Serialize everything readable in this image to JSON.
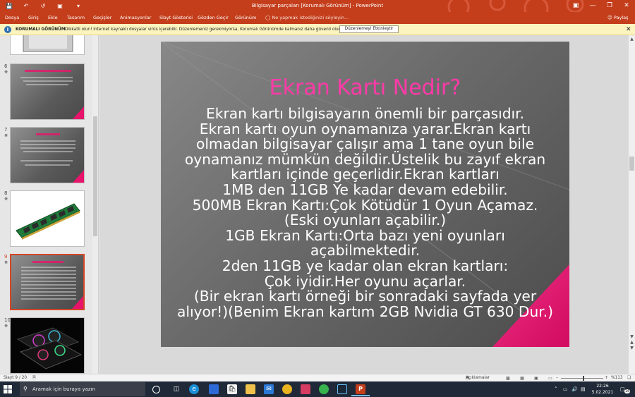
{
  "window": {
    "title": "Bilgisayar parçaları [Korumalı Görünüm] - PowerPoint"
  },
  "ribbon": {
    "tabs": [
      "Dosya",
      "Giriş",
      "Ekle",
      "Tasarım",
      "Geçişler",
      "Animasyonlar",
      "Slayt Gösterisi",
      "Gözden Geçir",
      "Görünüm"
    ],
    "tell_me_placeholder": "Ne yapmak istediğinizi söyleyin...",
    "share_label": "Paylaş"
  },
  "protected_view": {
    "heading": "KORUMALI GÖRÜNÜM",
    "message": "Dikkatli olun! Internet kaynaklı dosyalar virüs içerebilir. Düzenlemeniz gerekmiyorsa, Korumalı Görünümde kalmanız daha güvenli olur.",
    "enable_button": "Düzenlemeyi Etkinleştir"
  },
  "thumbnails": [
    {
      "number": "6"
    },
    {
      "number": "7"
    },
    {
      "number": "8"
    },
    {
      "number": "9"
    },
    {
      "number": "10"
    }
  ],
  "slide": {
    "title": "Ekran Kartı Nedir?",
    "body_lines": [
      "Ekran kartı bilgisayarın önemli bir parçasıdır.",
      "Ekran kartı oyun oynamanıza yarar.Ekran kartı",
      "olmadan bilgisayar çalışır ama 1 tane oyun bile",
      "oynamanız mümkün değildir.Üstelik bu zayıf ekran",
      "kartları içinde geçerlidir.Ekran kartları",
      "1MB den 11GB Ye kadar devam edebilir.",
      "500MB Ekran Kartı:Çok Kötüdür 1 Oyun Açamaz.",
      "(Eski oyunları açabilir.)",
      "1GB Ekran Kartı:Orta bazı yeni oyunları",
      "açabilmektedir.",
      "2den 11GB ye kadar olan ekran kartları:",
      "Çok iyidir.Her oyunu açarlar.",
      "(Bir ekran kartı örneği bir sonradaki sayfada yer",
      "alıyor!)(Benim Ekran kartım 2GB Nvidia GT 630 Dur.)"
    ]
  },
  "status": {
    "slide_counter": "Slayt 9 / 20",
    "notes_label": "Açıklamalar",
    "zoom": "%113"
  },
  "taskbar": {
    "search_placeholder": "Aramak için buraya yazın",
    "time": "22:26",
    "date": "5.02.2021",
    "notification_count": "16"
  },
  "colors": {
    "accent": "#c43e1c",
    "slide_title": "#ff3aa8",
    "slide_triangle": "#e8146c",
    "protected_bar": "#fcf4bf"
  }
}
